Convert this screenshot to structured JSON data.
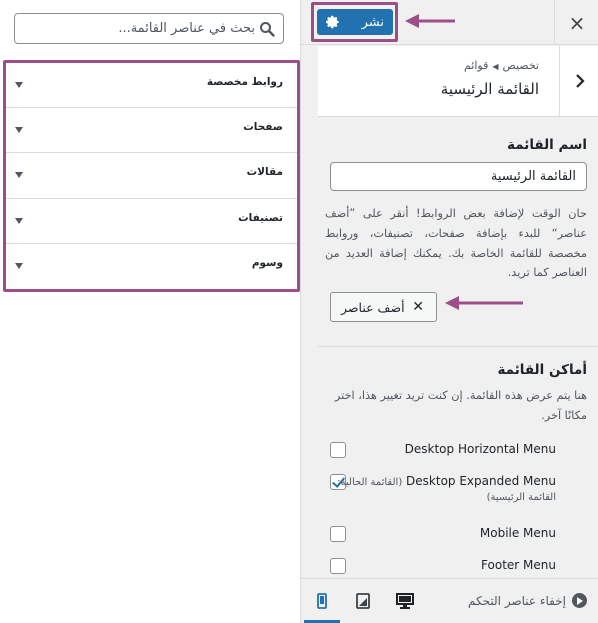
{
  "library": {
    "search_placeholder": "بحث في عناصر القائمة...",
    "sections": [
      {
        "title": "روابط مخصصة"
      },
      {
        "title": "صفحات"
      },
      {
        "title": "مقالات"
      },
      {
        "title": "تصنيفات"
      },
      {
        "title": "وسوم"
      }
    ]
  },
  "header": {
    "close_label": "×",
    "publish_label": "نشر"
  },
  "panel": {
    "breadcrumb": {
      "root": "تخصيص",
      "child": "قوائم"
    },
    "title": "القائمة الرئيسية",
    "menu_name_label": "اسم القائمة",
    "menu_name_value": "القائمة الرئيسية",
    "help_text": "حان الوقت لإضافة بعض الروابط! أنقر على ”أضف عناصر“ للبدء بإضافة صفحات، تصنيفات، وروابط مخصصة للقائمة الخاصة بك. يمكنك إضافة العديد من العناصر كما تريد.",
    "add_items_label": "أضف عناصر",
    "add_items_icon": "✕",
    "locations_label": "أماكن القائمة",
    "locations_help": "هنا يتم عرض هذه القائمة. إن كنت تريد تغيير هذا، اختر مكانًا آخر.",
    "locations": [
      {
        "name": "Desktop Horizontal Menu",
        "checked": false
      },
      {
        "name": "Desktop Expanded Menu",
        "checked": true,
        "current_prefix": "(القائمة الحالية:",
        "current_suffix": "القائمة الرئيسية)"
      },
      {
        "name": "Mobile Menu",
        "checked": false
      },
      {
        "name": "Footer Menu",
        "checked": false
      }
    ]
  },
  "footer": {
    "hide_controls_label": "إخفاء عناصر التحكم",
    "devices": [
      "desktop-icon",
      "tablet-icon",
      "mobile-icon"
    ]
  },
  "colors": {
    "accent": "#2271b1",
    "highlight": "#9b4f86"
  }
}
